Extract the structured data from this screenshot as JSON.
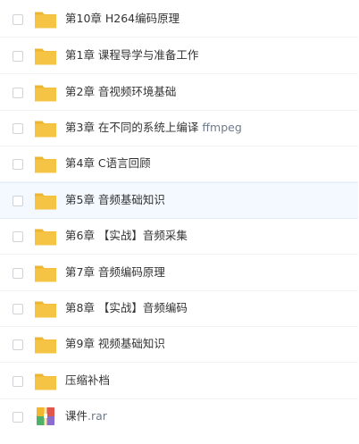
{
  "files": [
    {
      "label": "第10章 H264编码原理",
      "type": "folder"
    },
    {
      "label": "第1章 课程导学与准备工作",
      "type": "folder"
    },
    {
      "label": "第2章 音视频环境基础",
      "type": "folder"
    },
    {
      "label": "第3章 在不同的系统上编译",
      "suffix": "ffmpeg",
      "type": "folder"
    },
    {
      "label": "第4章 C语言回顾",
      "type": "folder"
    },
    {
      "label": "第5章 音频基础知识",
      "type": "folder",
      "highlighted": true
    },
    {
      "label": "第6章 【实战】音频采集",
      "type": "folder"
    },
    {
      "label": "第7章 音频编码原理",
      "type": "folder"
    },
    {
      "label": "第8章 【实战】音频编码",
      "type": "folder"
    },
    {
      "label": "第9章 视频基础知识",
      "type": "folder"
    },
    {
      "label": "压缩补档",
      "type": "folder"
    },
    {
      "label": "课件",
      "ext": ".rar",
      "type": "archive"
    }
  ],
  "colors": {
    "folder": "#f6c444",
    "folder_tab": "#eeb630",
    "highlight_row": "#f3f9fe",
    "text": "#333333",
    "muted_text": "#6f7a8a"
  },
  "icons": {
    "folder": "folder-icon",
    "archive": "archive-icon"
  }
}
